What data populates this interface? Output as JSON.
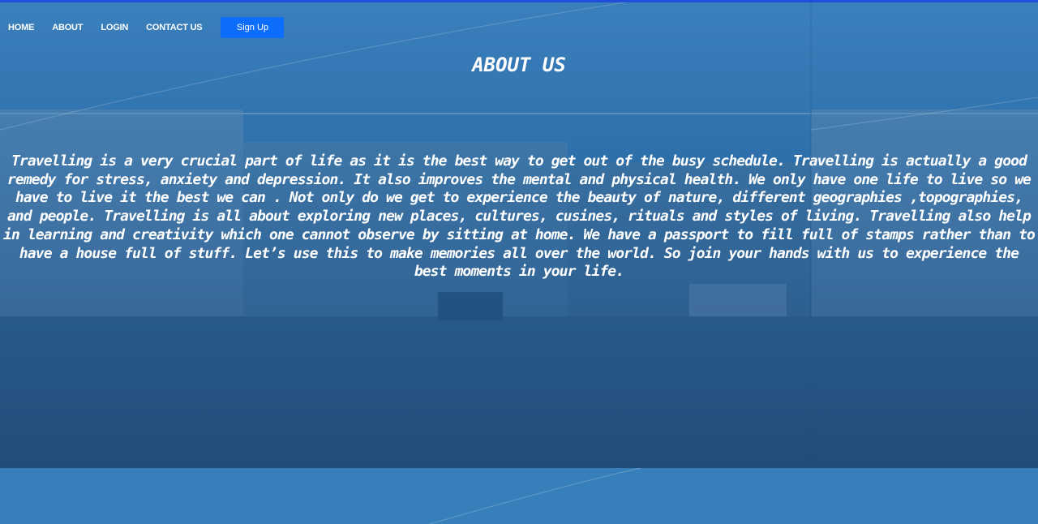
{
  "nav": {
    "items": [
      {
        "label": "HOME"
      },
      {
        "label": "ABOUT"
      },
      {
        "label": "LOGIN"
      },
      {
        "label": "CONTACT US"
      }
    ],
    "signup_label": "Sign Up"
  },
  "page": {
    "title": "ABOUT US",
    "body": "Travelling is a very crucial part of life as it is the best way to get out of the busy schedule. Travelling is actually a good remedy for stress, anxiety and depression. It also improves the mental and physical health. We only have one life to live so we have to live it the best we can . Not only do we get to experience the beauty of nature, different geographies ,topographies, and people. Travelling is all about exploring new places, cultures, cusines, rituals and styles of living. Travelling also help in learning and creativity which one cannot observe by sitting at home. We have a passport to fill full of stamps rather than to have a house full of stuff. Let’s use this to make memories all over the world. So join your hands with us to experience the best moments in your life."
  },
  "colors": {
    "top_border": "#1f4fd8",
    "signup_button": "#0d6efd",
    "overlay_top": "#3a80bd",
    "overlay_bottom": "#143f72",
    "page_background": "#377fbb"
  }
}
